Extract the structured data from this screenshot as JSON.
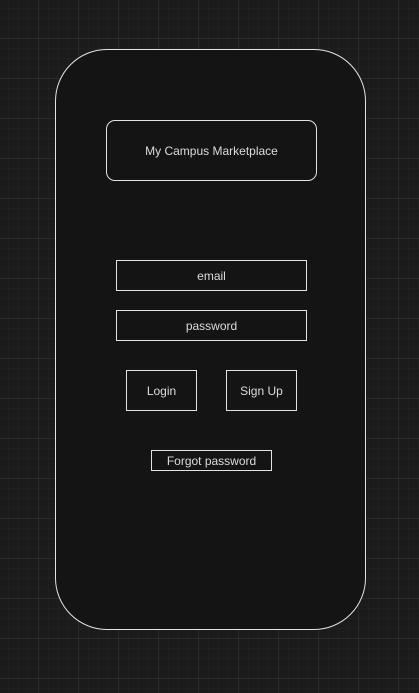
{
  "app": {
    "title": "My Campus Marketplace"
  },
  "login_form": {
    "email_placeholder": "email",
    "password_placeholder": "password"
  },
  "actions": {
    "login_label": "Login",
    "signup_label": "Sign Up",
    "forgot_password_label": "Forgot password"
  },
  "colors": {
    "canvas_background": "#1b1b1b",
    "phone_fill": "#141414",
    "stroke": "#e3e3e3",
    "text": "#dcdcdc"
  }
}
